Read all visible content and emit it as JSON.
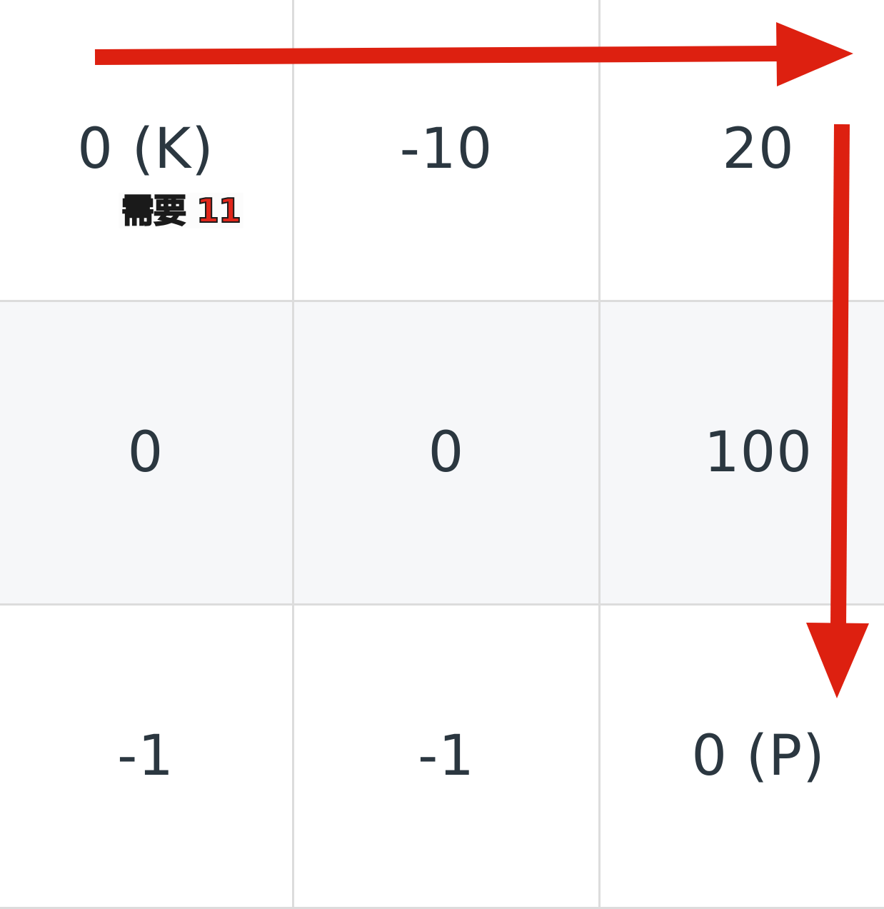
{
  "grid": {
    "rows": [
      [
        "0 (K)",
        "-10",
        "20"
      ],
      [
        "0",
        "0",
        "100"
      ],
      [
        "-1",
        "-1",
        "0 (P)"
      ]
    ]
  },
  "annotation": {
    "note": "需要 11"
  },
  "colors": {
    "arrow": "#dd2010",
    "grid_line": "#dcdcdc",
    "alt_row": "#f6f7f9",
    "text": "#2b3740"
  }
}
